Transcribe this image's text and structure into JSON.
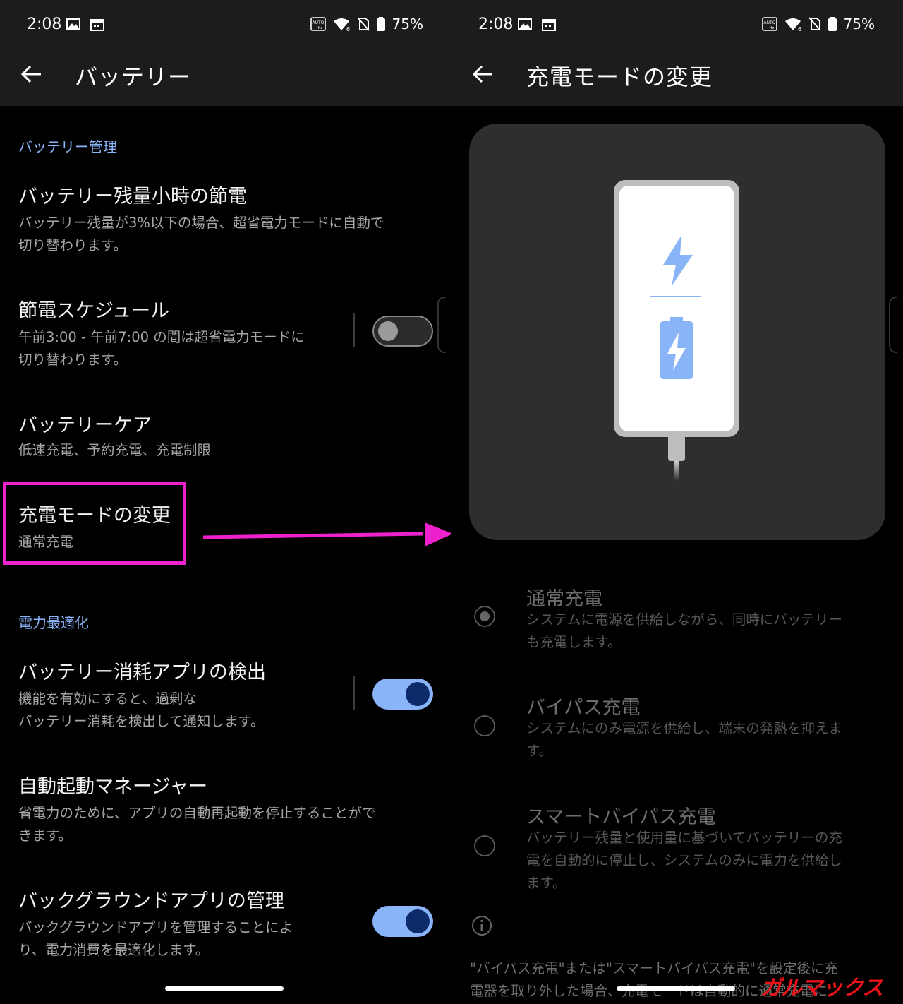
{
  "left_screen": {
    "status": {
      "time": "2:08",
      "battery": "75%"
    },
    "title": "バッテリー",
    "section_management": "バッテリー管理",
    "item_low_battery": {
      "title": "バッテリー残量小時の節電",
      "desc_line1": "バッテリー残量が3%以下の場合、超省電力モードに自動で",
      "desc_line2": "切り替わります。"
    },
    "item_schedule": {
      "title": "節電スケジュール",
      "desc_line1": "午前3:00 - 午前7:00 の間は超省電力モードに",
      "desc_line2": "切り替わります。",
      "enabled": false
    },
    "item_care": {
      "title": "バッテリーケア",
      "desc": "低速充電、予約充電、充電制限"
    },
    "item_charge_mode": {
      "title": "充電モードの変更",
      "desc": "通常充電"
    },
    "section_optimize": "電力最適化",
    "item_drain_detect": {
      "title": "バッテリー消耗アプリの検出",
      "desc_line1": "機能を有効にすると、過剰な",
      "desc_line2": "バッテリー消耗を検出して通知します。",
      "enabled": true
    },
    "item_autostart": {
      "title": "自動起動マネージャー",
      "desc_line1": "省電力のために、アプリの自動再起動を停止することがで",
      "desc_line2": "きます。"
    },
    "item_background": {
      "title": "バックグラウンドアプリの管理",
      "desc_line1": "バックグラウンドアプリを管理することによ",
      "desc_line2": "り、電力消費を最適化します。",
      "enabled": true
    }
  },
  "right_screen": {
    "status": {
      "time": "2:08",
      "battery": "75%"
    },
    "title": "充電モードの変更",
    "options": [
      {
        "title": "通常充電",
        "desc_line1": "システムに電源を供給しながら、同時にバッテリー",
        "desc_line2": "も充電します。",
        "selected": true
      },
      {
        "title": "バイパス充電",
        "desc_line1": "システムにのみ電源を供給し、端末の発熱を抑えま",
        "desc_line2": "す。",
        "selected": false
      },
      {
        "title": "スマートバイパス充電",
        "desc_line1": "バッテリー残量と使用量に基づいてバッテリーの充",
        "desc_line2": "電を自動的に停止し、システムのみに電力を供給し",
        "desc_line3": "ます。",
        "selected": false
      }
    ],
    "note_line1": "\"バイパス充電\"または\"スマートバイパス充電\"を設定後に充",
    "note_line2": "電器を取り外した場合、充電モードは自動的に通常充電に"
  },
  "colors": {
    "accent": "#8ab4f8",
    "highlight": "#ee22cc",
    "toggle_knob_on": "#0d2a6b",
    "illustration_bolt": "#8ab4f8"
  },
  "watermark": "ガルマックス"
}
